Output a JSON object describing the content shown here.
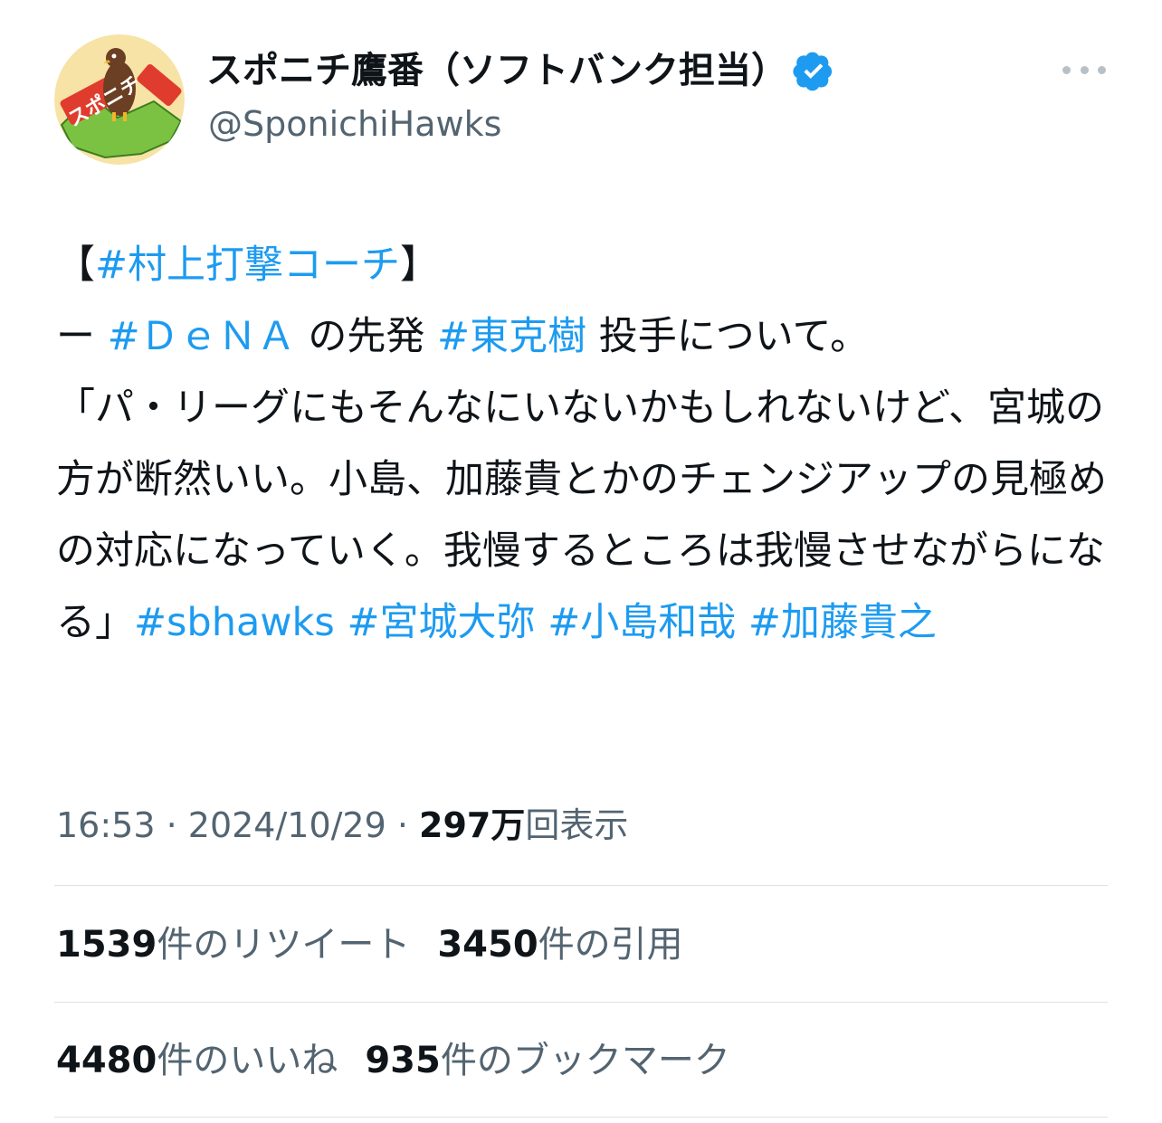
{
  "user": {
    "display_name": "スポニチ鷹番（ソフトバンク担当）",
    "handle": "@SponichiHawks",
    "avatar_text": "スポニチ",
    "verified_icon": "verified-badge-icon"
  },
  "tweet": {
    "line1_open": "【",
    "line1_tag": "#村上打撃コーチ",
    "line1_close": "】",
    "line2_a": "ー ",
    "line2_tag1": "#ＤｅＮＡ",
    "line2_b": " の先発 ",
    "line2_tag2": "#東克樹",
    "line2_c": " 投手について。",
    "quote": "「パ・リーグにもそんなにいないかもしれないけど、宮城の方が断然いい。小島、加藤貴とかのチェンジアップの見極めの対応になっていく。我慢するところは我慢させながらになる」",
    "tag_sbhawks": "#sbhawks",
    "tag_miyagi": "#宮城大弥",
    "tag_kojima": "#小島和哉",
    "tag_kato": "#加藤貴之"
  },
  "meta": {
    "time": "16:53",
    "sep": " · ",
    "date": "2024/10/29",
    "views_count": "297万",
    "views_label": "回表示"
  },
  "stats": {
    "retweets": "1539",
    "retweets_label": "件のリツイート",
    "quotes": "3450",
    "quotes_label": "件の引用",
    "likes": "4480",
    "likes_label": "件のいいね",
    "bookmarks": "935",
    "bookmarks_label": "件のブックマーク"
  },
  "colors": {
    "link": "#1d9bf0",
    "text": "#0f1419",
    "secondary": "#536471"
  }
}
